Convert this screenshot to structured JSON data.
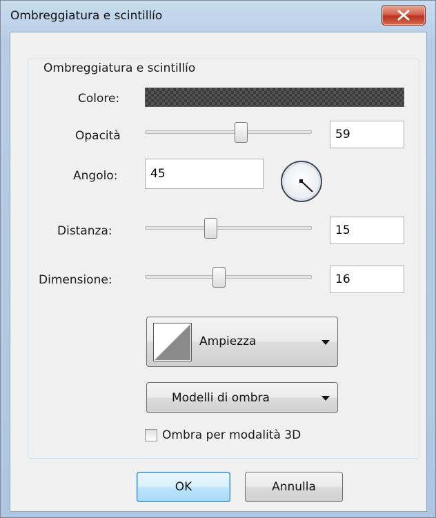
{
  "window": {
    "title": "Ombreggiatura e scintillío",
    "close_label": "X"
  },
  "group": {
    "title": "Ombreggiatura e scintillío"
  },
  "color": {
    "label": "Colore:"
  },
  "opacity": {
    "label": "Opacità",
    "value": "59",
    "slider_fraction": 0.59
  },
  "angle": {
    "label": "Angolo:",
    "value": "45"
  },
  "distance": {
    "label": "Distanza:",
    "value": "15"
  },
  "size": {
    "label": "Dimensione:",
    "value": "16"
  },
  "ampiezza_button": {
    "label": "Ampiezza"
  },
  "models_button": {
    "label": "Modelli di ombra"
  },
  "checkbox_3d": {
    "label": "Ombra per modalità 3D",
    "checked": false
  },
  "buttons": {
    "ok": "OK",
    "cancel": "Annulla"
  },
  "icons": {
    "close": "close-icon",
    "dropdown": "chevron-down-icon",
    "dial": "angle-dial-icon",
    "contour": "contour-preview-icon"
  },
  "colors": {
    "close_button": "#c9452f",
    "dialog_bg": "#f0f0f0",
    "frame": "#b7cde6"
  }
}
